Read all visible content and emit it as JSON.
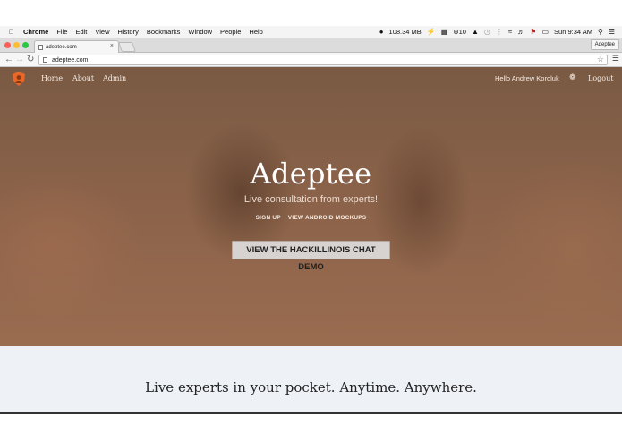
{
  "menubar": {
    "app_name": "Chrome",
    "items": [
      "File",
      "Edit",
      "View",
      "History",
      "Bookmarks",
      "Window",
      "People",
      "Help"
    ],
    "status": {
      "memory": "108.34 MB",
      "notifications": "10",
      "clock": "Sun 9:34 AM"
    }
  },
  "browser": {
    "tab_title": "adeptee.com",
    "profile": "Adeptee",
    "url": "adeptee.com"
  },
  "site": {
    "nav": {
      "home": "Home",
      "about": "About",
      "admin": "Admin",
      "greeting": "Hello Andrew Koroluk",
      "logout": "Logout"
    },
    "hero": {
      "title": "Adeptee",
      "subtitle": "Live consultation from experts!",
      "signup": "SIGN UP",
      "mockups": "VIEW ANDROID MOCKUPS",
      "demo_button": "VIEW THE HACKILLINOIS CHAT DEMO"
    },
    "tagline": "Live experts in your pocket. Anytime. Anywhere."
  },
  "colors": {
    "logo_orange": "#e8682a",
    "hero_brown": "#8a6249",
    "lower_bg": "#eef1f5"
  }
}
